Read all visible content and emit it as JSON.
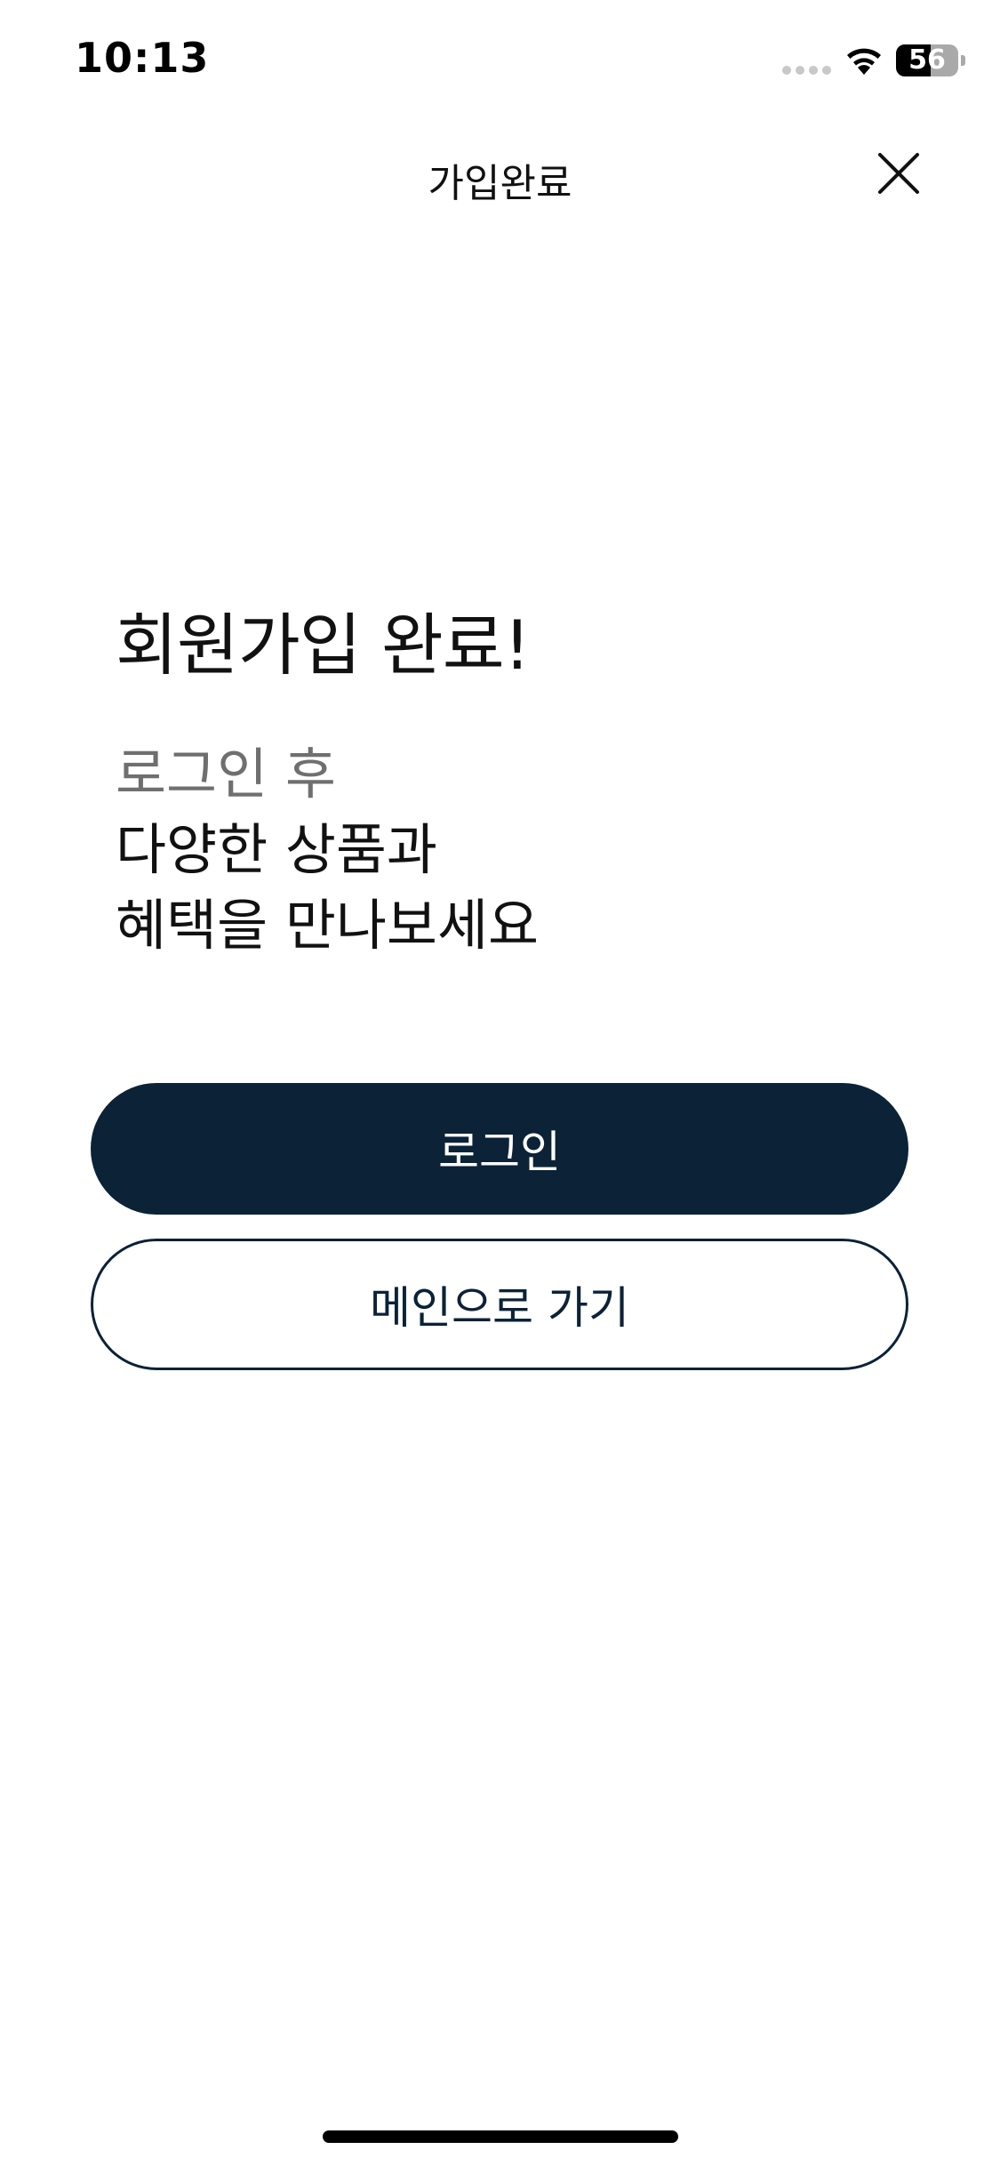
{
  "status_bar": {
    "time": "10:13",
    "battery_level": "56",
    "battery_fraction": 0.56
  },
  "nav": {
    "title": "가입완료",
    "close_icon": "close-icon"
  },
  "content": {
    "headline": "회원가입 완료!",
    "sub_gray": "로그인 후",
    "sub_line_1": "다양한 상품과",
    "sub_line_2": "혜택을 만나보세요"
  },
  "buttons": {
    "login_label": "로그인",
    "main_label": "메인으로 가기"
  },
  "colors": {
    "primary": "#0b2237",
    "muted_text": "#6f6f6f"
  }
}
